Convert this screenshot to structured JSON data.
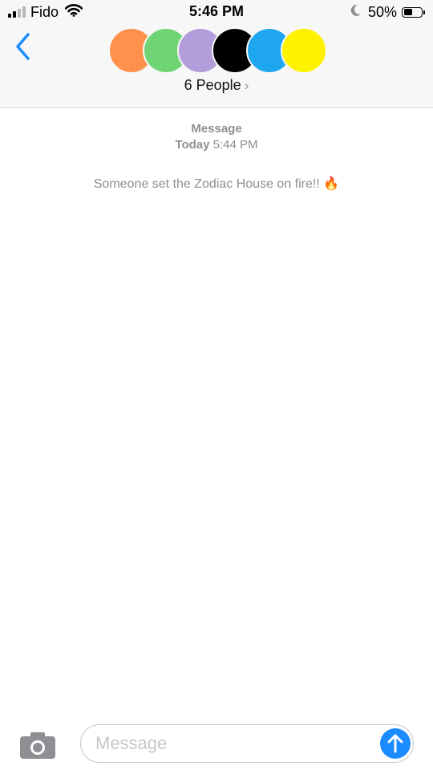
{
  "status_bar": {
    "carrier": "Fido",
    "time": "5:46 PM",
    "battery_percent": "50%",
    "battery_level": 0.5,
    "signal_bars_filled": 2,
    "signal_bars_total": 4,
    "icons": [
      "signal-icon",
      "wifi-icon",
      "moon-icon",
      "battery-icon"
    ]
  },
  "header": {
    "back_icon": "chevron-left-icon",
    "people_label": "6 People",
    "people_chevron": "›",
    "avatars": [
      {
        "color": "#ff914d"
      },
      {
        "color": "#6fd474"
      },
      {
        "color": "#b39ddb"
      },
      {
        "color": "#000000"
      },
      {
        "color": "#1ea7f0"
      },
      {
        "color": "#fff200"
      }
    ]
  },
  "conversation": {
    "service_label": "Message",
    "date_day": "Today",
    "date_time": "5:44 PM",
    "messages": [
      {
        "text": "Someone set the Zodiac House on fire!! 🔥"
      }
    ]
  },
  "input_bar": {
    "placeholder": "Message",
    "camera_icon": "camera-icon",
    "send_icon": "arrow-up-icon"
  },
  "colors": {
    "accent": "#1a8cff",
    "header_bg": "#f7f7f7",
    "secondary_text": "#8e8e93"
  }
}
